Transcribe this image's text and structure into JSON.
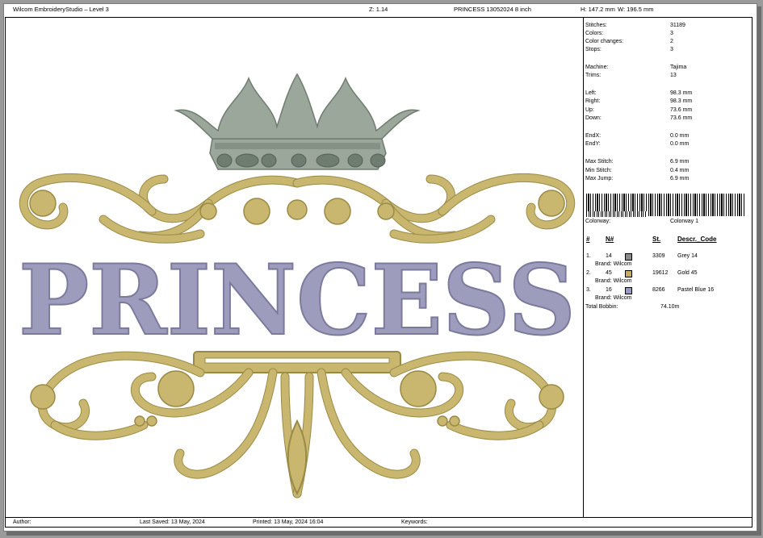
{
  "header": {
    "app_title": "Wilcom EmbroideryStudio – Level 3",
    "zoom": "Z: 1.14",
    "design_name": "PRINCESS 13052024 8 inch",
    "height": "H: 147.2 mm",
    "width": "W: 196.5 mm"
  },
  "design": {
    "text": "PRINCESS",
    "colors": {
      "crown": "#9aa79a",
      "crown_dark": "#6f7c70",
      "gold": "#c9b76f",
      "gold_dark": "#9a8a45",
      "blue": "#9d9cbd",
      "blue_dark": "#7b7a9c"
    }
  },
  "info": [
    {
      "label": "Stitches:",
      "value": "31189"
    },
    {
      "label": "Colors:",
      "value": "3"
    },
    {
      "label": "Color changes:",
      "value": "2"
    },
    {
      "label": "Stops:",
      "value": "3"
    },
    {
      "label": "Machine:",
      "value": "Tajima"
    },
    {
      "label": "Trims:",
      "value": "13"
    },
    {
      "label": "Left:",
      "value": "98.3 mm"
    },
    {
      "label": "Right:",
      "value": "98.3 mm"
    },
    {
      "label": "Up:",
      "value": "73.6 mm"
    },
    {
      "label": "Down:",
      "value": "73.6 mm"
    },
    {
      "label": "EndX:",
      "value": "0.0 mm"
    },
    {
      "label": "EndY:",
      "value": "0.0 mm"
    },
    {
      "label": "Max Stitch:",
      "value": "6.9 mm"
    },
    {
      "label": "Min Stitch:",
      "value": "0.4 mm"
    },
    {
      "label": "Max Jump:",
      "value": "6.9 mm"
    }
  ],
  "colorway": {
    "label": "Colorway:",
    "value": "Colorway 1"
  },
  "table": {
    "headers": [
      "#",
      "N#",
      "St.",
      "Descr._Code"
    ],
    "rows": [
      {
        "idx": "1.",
        "n": "14",
        "st": "3309",
        "descr": "Grey 14",
        "brand": "Brand: Wilcom",
        "color": "#8a8a8a"
      },
      {
        "idx": "2.",
        "n": "45",
        "st": "19612",
        "descr": "Gold 45",
        "brand": "Brand: Wilcom",
        "color": "#c9a968"
      },
      {
        "idx": "3.",
        "n": "16",
        "st": "8266",
        "descr": "Pastel Blue 16",
        "brand": "Brand: Wilcom",
        "color": "#9a99c4"
      }
    ],
    "total_label": "Total Bobbin:",
    "total_value": "74.10m"
  },
  "footer": {
    "author": "Author:",
    "last_saved": "Last Saved:  13 May, 2024",
    "printed": "Printed:  13 May, 2024 16:04",
    "keywords": "Keywords:"
  }
}
